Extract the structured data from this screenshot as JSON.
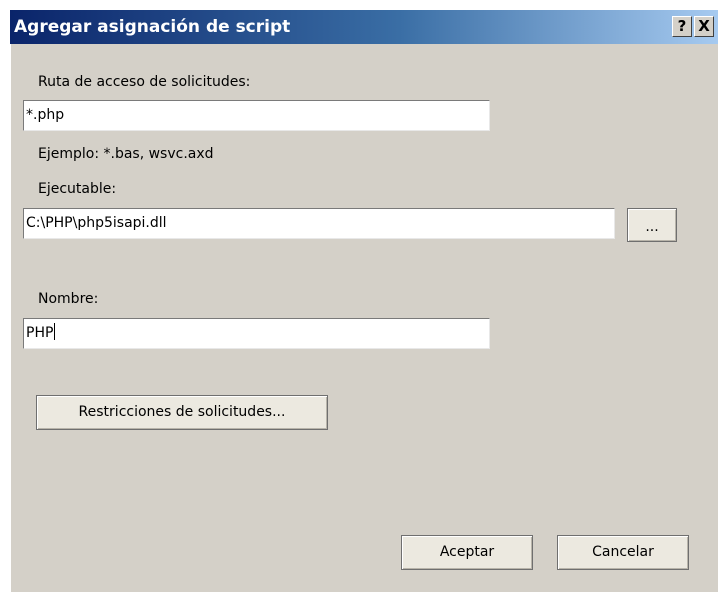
{
  "dialog": {
    "title": "Agregar asignación de script",
    "help_button": "?",
    "close_button": "X"
  },
  "request_path": {
    "label": "Ruta de acceso de solicitudes:",
    "value": "*.php",
    "example": "Ejemplo: *.bas, wsvc.axd"
  },
  "executable": {
    "label": "Ejecutable:",
    "value": "C:\\PHP\\php5isapi.dll",
    "browse_button": "..."
  },
  "name": {
    "label": "Nombre:",
    "value": "PHP"
  },
  "restrictions_button": "Restricciones de solicitudes...",
  "footer": {
    "ok_button": "Aceptar",
    "cancel_button": "Cancelar"
  }
}
